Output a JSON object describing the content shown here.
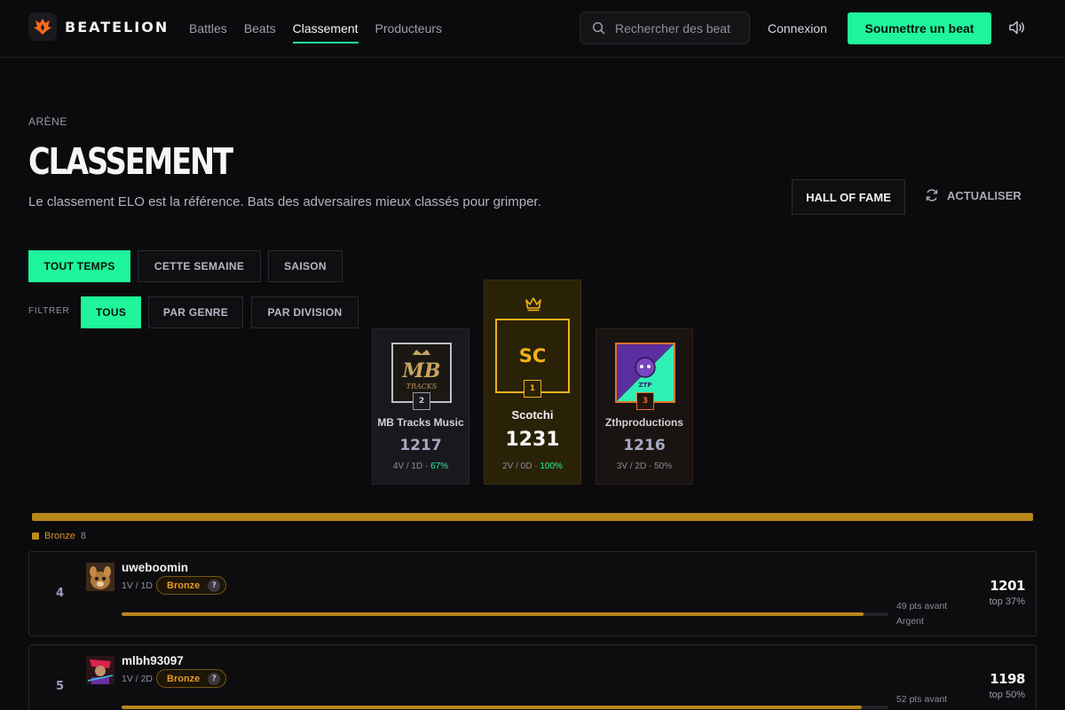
{
  "brand": {
    "name": "BEATELION",
    "logo_icon": "flame-crest-icon",
    "accent": "#1ff59a"
  },
  "nav": {
    "items": [
      {
        "label": "Battles",
        "active": false
      },
      {
        "label": "Beats",
        "active": false
      },
      {
        "label": "Classement",
        "active": true
      },
      {
        "label": "Producteurs",
        "active": false
      }
    ]
  },
  "search": {
    "placeholder": "Rechercher des beat",
    "icon": "search-icon"
  },
  "header": {
    "login_label": "Connexion",
    "submit_label": "Soumettre un beat",
    "sound_icon": "speaker-icon"
  },
  "page": {
    "eyebrow": "ARÈNE",
    "title": "CLASSEMENT",
    "subtitle": "Le classement ELO est la référence. Bats des adversaires mieux classés pour grimper.",
    "hall_of_fame_label": "HALL OF FAME",
    "refresh_label": "ACTUALISER"
  },
  "periods": [
    "TOUT TEMPS",
    "CETTE SEMAINE",
    "SAISON"
  ],
  "active_period": "TOUT TEMPS",
  "filter": {
    "label": "FILTRER",
    "options": [
      "TOUS",
      "PAR GENRE",
      "PAR DIVISION"
    ],
    "active": "TOUS"
  },
  "podium": {
    "first": {
      "rank": "1",
      "initials": "SC",
      "name": "Scotchi",
      "elo": "1231",
      "record": "2V / 0D · ",
      "winrate": "100%",
      "crown_icon": "crown-icon",
      "color": "#f2b21c"
    },
    "second": {
      "rank": "2",
      "name": "MB Tracks Music",
      "elo": "1217",
      "record": "4V / 1D · ",
      "winrate": "67%",
      "avatar_text": "MB",
      "avatar_sub": "TRACKS"
    },
    "third": {
      "rank": "3",
      "name": "Zthproductions",
      "elo": "1216",
      "record": "3V / 2D · ",
      "winrate": "50%",
      "avatar_text": "ZTP"
    }
  },
  "division": {
    "name": "Bronze",
    "count": "8",
    "color": "#b8861b"
  },
  "rows": [
    {
      "rank": "4",
      "username": "uweboomin",
      "record": "1V / 1D",
      "division": "Bronze",
      "help": "?",
      "progress": 0.968,
      "pts_before": "49 pts avant",
      "next_division": "Argent",
      "elo": "1201",
      "top": "top 37%"
    },
    {
      "rank": "5",
      "username": "mlbh93097",
      "record": "1V / 2D",
      "division": "Bronze",
      "help": "?",
      "progress": 0.965,
      "pts_before": "52 pts avant",
      "next_division": "",
      "elo": "1198",
      "top": "top 50%"
    }
  ]
}
